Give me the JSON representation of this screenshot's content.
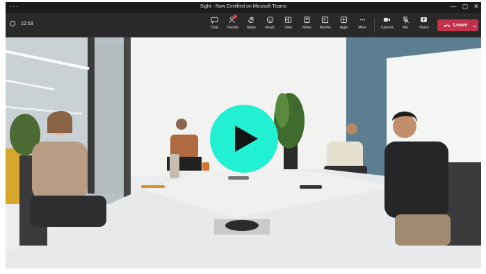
{
  "window": {
    "title": "Sight - Now Certified on Micosoft Teams",
    "menu": "···",
    "minimize": "—",
    "maximize": "▢",
    "close": "✕"
  },
  "toolbar": {
    "timer": "22:03",
    "people_badge": "1",
    "buttons": [
      {
        "id": "chat",
        "label": "Chat",
        "icon": "chat-icon"
      },
      {
        "id": "people",
        "label": "People",
        "icon": "people-icon"
      },
      {
        "id": "raise",
        "label": "Raise",
        "icon": "hand-icon"
      },
      {
        "id": "react",
        "label": "React",
        "icon": "smile-icon"
      },
      {
        "id": "view",
        "label": "View",
        "icon": "view-icon"
      },
      {
        "id": "notes",
        "label": "Notes",
        "icon": "notes-icon"
      },
      {
        "id": "rooms",
        "label": "Rooms",
        "icon": "rooms-icon"
      },
      {
        "id": "apps",
        "label": "Apps",
        "icon": "apps-icon"
      },
      {
        "id": "more",
        "label": "More",
        "icon": "more-icon"
      }
    ],
    "media": [
      {
        "id": "camera",
        "label": "Camera",
        "icon": "camera-icon"
      },
      {
        "id": "mic",
        "label": "Mic",
        "icon": "mic-muted-icon"
      },
      {
        "id": "share",
        "label": "Share",
        "icon": "share-icon"
      }
    ],
    "leave_label": "Leave",
    "leave_chevron": "⌄"
  },
  "colors": {
    "accent_play": "#22f0d2",
    "leave": "#c4314b",
    "toolbar": "#292929"
  }
}
